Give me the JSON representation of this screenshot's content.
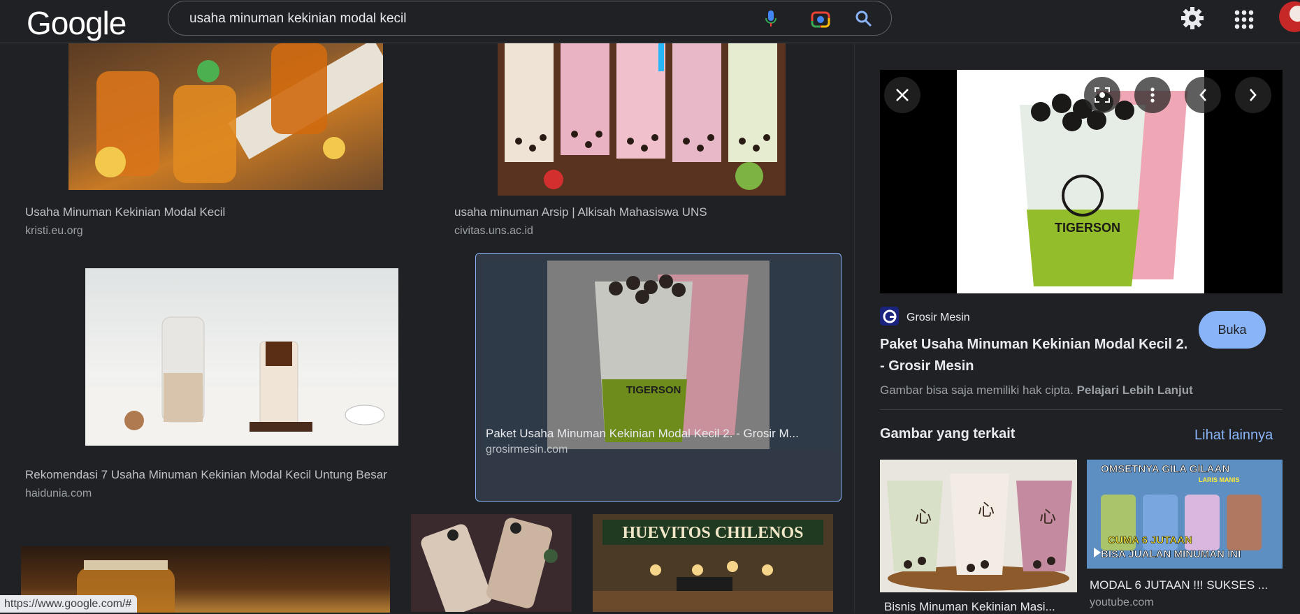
{
  "header": {
    "logo": "Google",
    "search_query": "usaha minuman kekinian modal kecil"
  },
  "results": [
    {
      "title": "Usaha Minuman Kekinian Modal Kecil",
      "site": "kristi.eu.org"
    },
    {
      "title": "usaha minuman Arsip | Alkisah Mahasiswa UNS",
      "site": "civitas.uns.ac.id"
    },
    {
      "title": "Rekomendasi 7 Usaha Minuman Kekinian Modal Kecil Untung Besar",
      "site": "haidunia.com"
    },
    {
      "title": "Paket Usaha Minuman Kekinian Modal Kecil 2. - Grosir M...",
      "site": "grosirmesin.com"
    }
  ],
  "bottom_thumb_text": "HUEVITOS CHILENOS",
  "preview_panel": {
    "source_name": "Grosir Mesin",
    "title": "Paket Usaha Minuman Kekinian Modal Kecil 2. - Grosir Mesin",
    "open_button": "Buka",
    "copyright_text": "Gambar bisa saja memiliki hak cipta.",
    "learn_more": "Pelajari Lebih Lanjut",
    "related_heading": "Gambar yang terkait",
    "see_more": "Lihat lainnya",
    "related": [
      {
        "title": "Bisnis Minuman Kekinian Masi...",
        "site": ""
      },
      {
        "title": "MODAL 6 JUTAAN !!! SUKSES ...",
        "site": "youtube.com",
        "overlay_top": "OMSETNYA GILA GILAAN",
        "overlay_sub": "LARIS MANIS",
        "overlay_mid": "CUMA 6 JUTAAN",
        "overlay_bottom": "BISA JUALAN MINUMAN INI"
      }
    ],
    "cup_brand": "TIGERSON"
  },
  "status_url": "https://www.google.com/#",
  "colors": {
    "accent": "#8ab4f8",
    "background": "#202124"
  }
}
